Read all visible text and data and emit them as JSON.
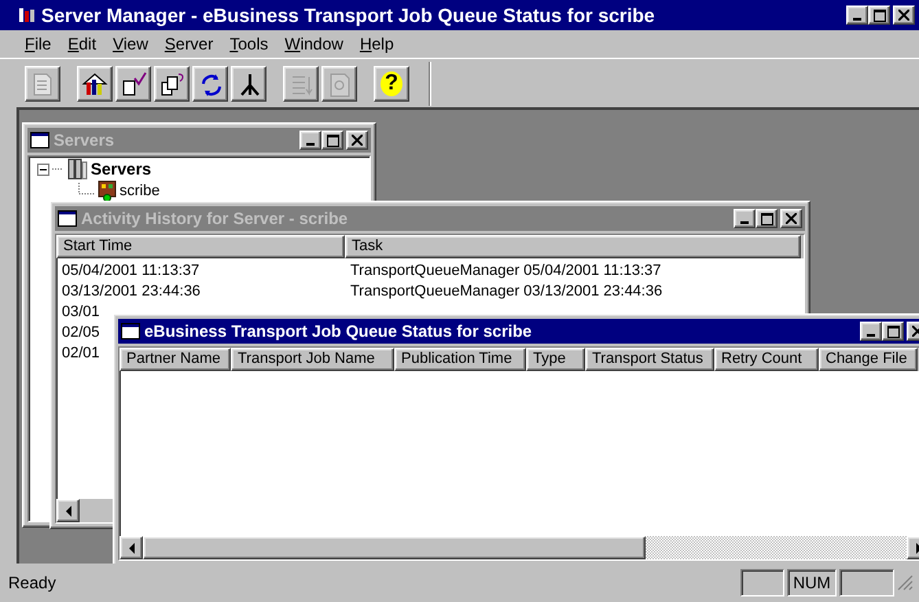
{
  "window": {
    "title": "Server Manager - eBusiness Transport Job Queue Status for scribe",
    "active": true
  },
  "menu": [
    {
      "label": "File"
    },
    {
      "label": "Edit"
    },
    {
      "label": "View"
    },
    {
      "label": "Server"
    },
    {
      "label": "Tools"
    },
    {
      "label": "Window"
    },
    {
      "label": "Help"
    }
  ],
  "toolbar": [
    {
      "buttons": [
        {
          "kind": "document",
          "disabled": true
        }
      ]
    },
    {
      "buttons": [
        {
          "kind": "chart",
          "disabled": false
        },
        {
          "kind": "check",
          "disabled": false
        },
        {
          "kind": "query",
          "disabled": false
        },
        {
          "kind": "refresh",
          "disabled": false
        },
        {
          "kind": "tree",
          "disabled": false
        }
      ]
    },
    {
      "buttons": [
        {
          "kind": "list",
          "disabled": true
        },
        {
          "kind": "report",
          "disabled": true
        }
      ]
    },
    {
      "buttons": [
        {
          "kind": "help",
          "disabled": false,
          "glyph": "?"
        }
      ]
    }
  ],
  "windows": [
    {
      "kind": "tree",
      "title": "Servers",
      "active": false,
      "tree": [
        {
          "label": "Servers",
          "expanded": true,
          "children": [
            {
              "label": "scribe"
            }
          ]
        }
      ]
    },
    {
      "kind": "list",
      "title": "Activity History for Server - scribe",
      "active": false,
      "columns": [
        "Start Time",
        "Task"
      ],
      "rows": [
        [
          "05/04/2001 11:13:37",
          "TransportQueueManager 05/04/2001 11:13:37"
        ],
        [
          "03/13/2001 23:44:36",
          "TransportQueueManager 03/13/2001 23:44:36"
        ],
        [
          "03/01"
        ],
        [
          "02/05"
        ],
        [
          "02/01"
        ]
      ]
    },
    {
      "kind": "list",
      "title": "eBusiness Transport Job Queue Status for scribe",
      "active": true,
      "columns": [
        "Partner Name",
        "Transport Job Name",
        "Publication Time",
        "Type",
        "Transport Status",
        "Retry Count",
        "Change File"
      ]
    }
  ],
  "status_bar": {
    "text": "Ready",
    "indicators": [
      {
        "label": "NUM"
      }
    ]
  }
}
